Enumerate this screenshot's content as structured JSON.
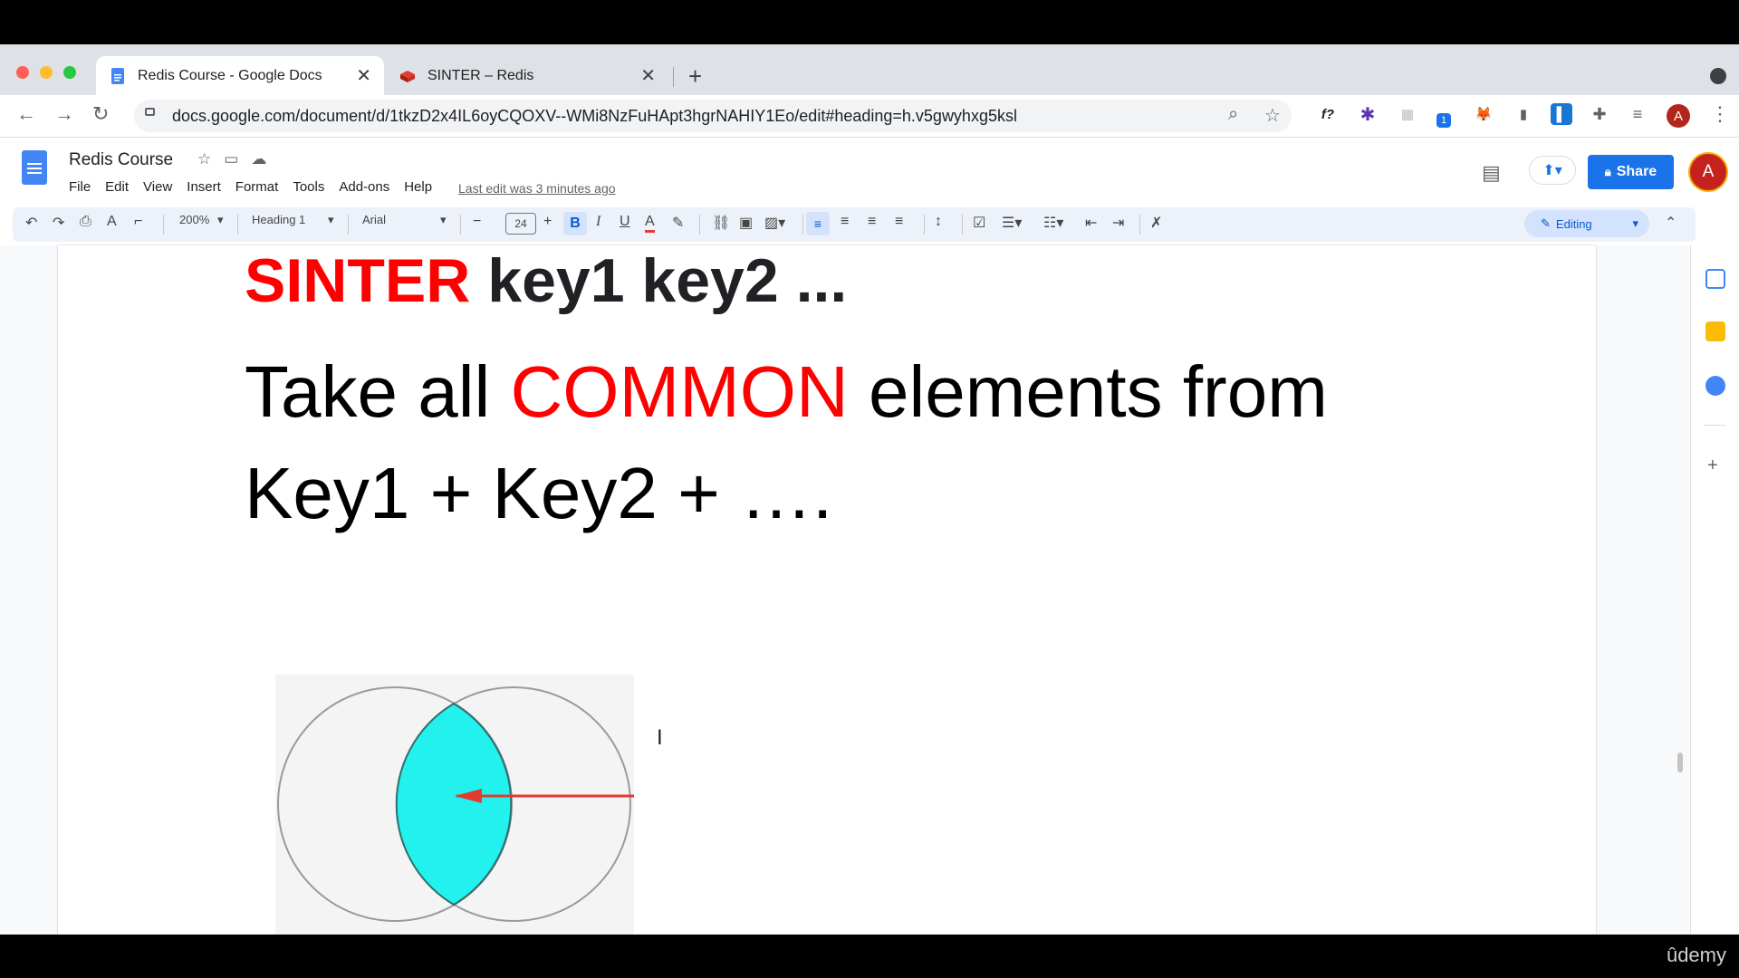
{
  "browser": {
    "tabs": [
      {
        "label": "Redis Course - Google Docs",
        "active": true,
        "icon": "google-docs-icon"
      },
      {
        "label": "SINTER – Redis",
        "active": false,
        "icon": "redis-icon"
      }
    ],
    "url": "docs.google.com/document/d/1tkzD2x4IL6oyCQOXV--WMi8NzFuHApt3hgrNAHIY1Eo/edit#heading=h.v5gwyhxg5ksl",
    "extensions": [
      "f?",
      "✱",
      "▦",
      "1",
      "🦊",
      "▮",
      "▌",
      "✚",
      "≡"
    ],
    "profile_initial": "A"
  },
  "docs": {
    "title": "Redis Course",
    "menu": [
      "File",
      "Edit",
      "View",
      "Insert",
      "Format",
      "Tools",
      "Add-ons",
      "Help"
    ],
    "last_edit": "Last edit was 3 minutes ago",
    "share_label": "Share",
    "avatar_initial": "A"
  },
  "toolbar": {
    "zoom": "200%",
    "style": "Heading 1",
    "font": "Arial",
    "font_size": "24",
    "mode": "Editing"
  },
  "document": {
    "heading_red": "SINTER",
    "heading_rest": " key1 key2 ...",
    "line1_a": "Take all ",
    "line1_red": "COMMON",
    "line1_b": " elements from",
    "line2": "Key1 + Key2 + …."
  },
  "watermark": "ûdemy",
  "colors": {
    "accent": "#1a73e8",
    "highlight_red": "#ff0000",
    "venn_fill": "#22f1ee",
    "arrow": "#e23b2e"
  }
}
